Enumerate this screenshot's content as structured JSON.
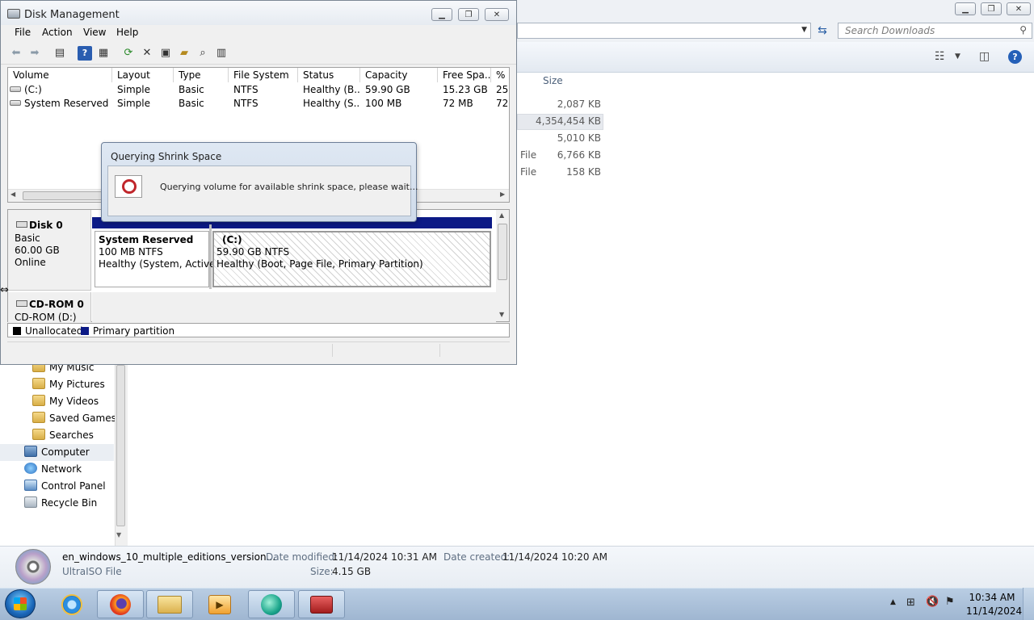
{
  "explorer": {
    "search_placeholder": "Search Downloads",
    "size_header": "Size",
    "file_rows": [
      {
        "type": "",
        "size": "2,087 KB"
      },
      {
        "type": "",
        "size": "4,354,454 KB"
      },
      {
        "type": "",
        "size": "5,010 KB"
      },
      {
        "type": "File",
        "size": "6,766 KB"
      },
      {
        "type": "File",
        "size": "158 KB"
      }
    ],
    "nav_items": [
      {
        "label": "My Music"
      },
      {
        "label": "My Pictures"
      },
      {
        "label": "My Videos"
      },
      {
        "label": "Saved Games"
      },
      {
        "label": "Searches"
      },
      {
        "label": "Computer"
      },
      {
        "label": "Network"
      },
      {
        "label": "Control Panel"
      },
      {
        "label": "Recycle Bin"
      }
    ],
    "details": {
      "file_name": "en_windows_10_multiple_editions_version...",
      "file_type": "UltraISO File",
      "modified_label": "Date modified:",
      "modified_value": "11/14/2024 10:31 AM",
      "created_label": "Date created:",
      "created_value": "11/14/2024 10:20 AM",
      "size_label": "Size:",
      "size_value": "4.15 GB"
    }
  },
  "taskbar": {
    "time": "10:34 AM",
    "date": "11/14/2024"
  },
  "disk_mgmt": {
    "title": "Disk Management",
    "menu": [
      "File",
      "Action",
      "View",
      "Help"
    ],
    "columns": [
      "Volume",
      "Layout",
      "Type",
      "File System",
      "Status",
      "Capacity",
      "Free Spa...",
      "% F"
    ],
    "volumes": [
      {
        "volume": "(C:)",
        "layout": "Simple",
        "type": "Basic",
        "fs": "NTFS",
        "status": "Healthy (B...",
        "capacity": "59.90 GB",
        "free": "15.23 GB",
        "pct": "25"
      },
      {
        "volume": "System Reserved",
        "layout": "Simple",
        "type": "Basic",
        "fs": "NTFS",
        "status": "Healthy (S...",
        "capacity": "100 MB",
        "free": "72 MB",
        "pct": "72"
      }
    ],
    "disk0": {
      "name": "Disk 0",
      "type": "Basic",
      "size": "60.00 GB",
      "state": "Online",
      "partitions": [
        {
          "name": "System Reserved",
          "size": "100 MB NTFS",
          "status": "Healthy (System, Active,"
        },
        {
          "name": "(C:)",
          "size": "59.90 GB NTFS",
          "status": "Healthy (Boot, Page File, Primary Partition)"
        }
      ]
    },
    "cdrom": {
      "name": "CD-ROM 0",
      "drive": "CD-ROM (D:)"
    },
    "legend": [
      {
        "label": "Unallocated",
        "color": "#000000"
      },
      {
        "label": "Primary partition",
        "color": "#0c1a86"
      }
    ]
  },
  "dialog": {
    "title": "Querying Shrink Space",
    "message": "Querying volume for available shrink space, please wait..."
  }
}
